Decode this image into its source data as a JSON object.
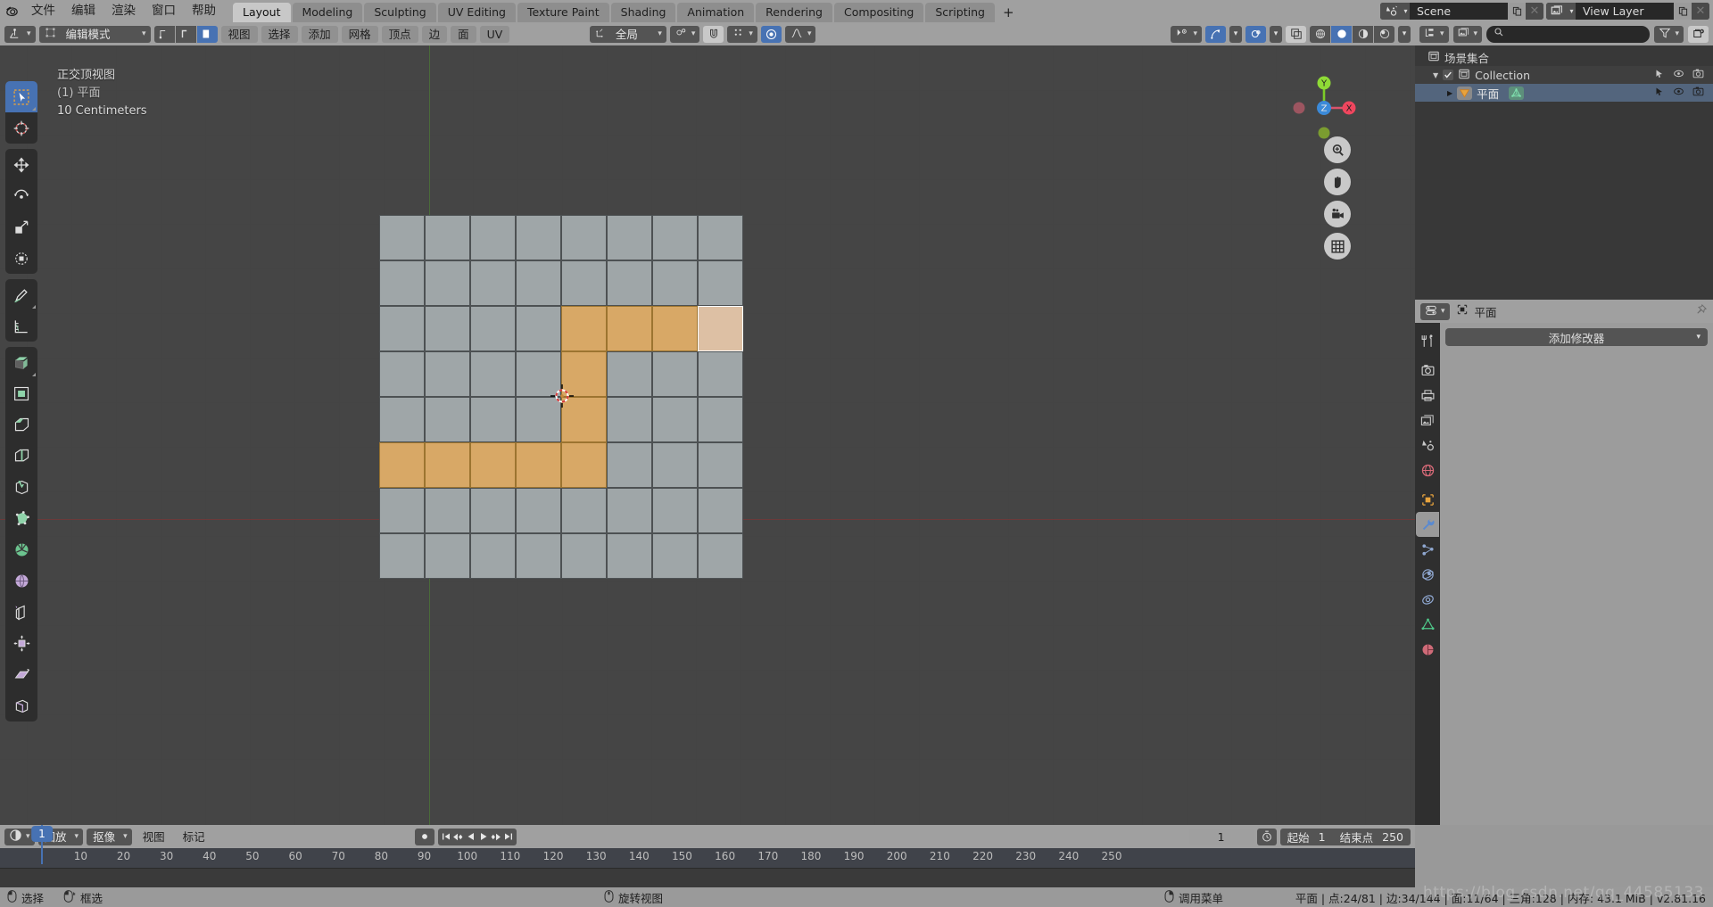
{
  "topbar": {
    "logo_icon": "blender-logo-icon",
    "menus": [
      "文件",
      "编辑",
      "渲染",
      "窗口",
      "帮助"
    ],
    "workspace_tabs": [
      {
        "label": "Layout",
        "active": true
      },
      {
        "label": "Modeling",
        "active": false
      },
      {
        "label": "Sculpting",
        "active": false
      },
      {
        "label": "UV Editing",
        "active": false
      },
      {
        "label": "Texture Paint",
        "active": false
      },
      {
        "label": "Shading",
        "active": false
      },
      {
        "label": "Animation",
        "active": false
      },
      {
        "label": "Rendering",
        "active": false
      },
      {
        "label": "Compositing",
        "active": false
      },
      {
        "label": "Scripting",
        "active": false
      }
    ],
    "add_workspace_label": "+",
    "scene": {
      "icon": "scene-icon",
      "value": "Scene",
      "new_label": "new-scene-icon",
      "unlink_label": "✕"
    },
    "view_layer": {
      "icon": "view-layer-icon",
      "value": "View Layer",
      "new_label": "new-layer-icon",
      "unlink_label": "✕"
    }
  },
  "viewport": {
    "header": {
      "editor_type_icon": "editor-type-3dview-icon",
      "mode": "编辑模式",
      "select_modes": [
        "vertex-select-icon",
        "edge-select-icon",
        "face-select-icon"
      ],
      "active_select_mode": 2,
      "menus": [
        "视图",
        "选择",
        "添加",
        "网格",
        "顶点",
        "边",
        "面",
        "UV"
      ],
      "transform_orientation": {
        "icon": "orientation-icon",
        "value": "全局"
      },
      "snap": {
        "icon": "snap-magnet-icon",
        "enabled": false
      },
      "proportional": {
        "icon": "proportional-edit-icon",
        "enabled": true,
        "falloff_icon": "falloff-smooth-icon"
      },
      "snap_target_icon": "snap-target-icon",
      "right": {
        "visibility_icon": "object-visibility-icon",
        "gizmo_icon": "gizmo-icon",
        "gizmo_enabled": true,
        "overlays_icon": "overlays-icon",
        "overlays_enabled": true,
        "xray_icon": "xray-toggle-icon",
        "shading_modes": [
          "wireframe-shading-icon",
          "solid-shading-icon",
          "material-preview-icon",
          "rendered-shading-icon"
        ],
        "active_shading": 1
      }
    },
    "overlay_text": {
      "view_name": "正交顶视图",
      "collection_object": "(1) 平面",
      "grid_scale": "10 Centimeters"
    },
    "toolbar": [
      {
        "name": "tweak-tool",
        "icon": "cursor-arrow-icon",
        "active": true
      },
      {
        "name": "cursor-tool",
        "icon": "3d-cursor-icon",
        "active": false
      },
      {
        "name": "move-tool",
        "icon": "move-arrows-icon",
        "active": false
      },
      {
        "name": "rotate-tool",
        "icon": "rotate-icon",
        "active": false
      },
      {
        "name": "scale-tool",
        "icon": "scale-icon",
        "active": false
      },
      {
        "name": "transform-tool",
        "icon": "transform-icon",
        "active": false
      },
      {
        "name": "annotate-tool",
        "icon": "pencil-icon",
        "active": false
      },
      {
        "name": "measure-tool",
        "icon": "ruler-icon",
        "active": false
      },
      {
        "name": "extrude-region-tool",
        "icon": "extrude-region-icon",
        "active": false
      },
      {
        "name": "inset-faces-tool",
        "icon": "inset-faces-icon",
        "active": false
      },
      {
        "name": "bevel-tool",
        "icon": "bevel-icon",
        "active": false
      },
      {
        "name": "loop-cut-tool",
        "icon": "loop-cut-icon",
        "active": false
      },
      {
        "name": "knife-tool",
        "icon": "knife-icon",
        "active": false
      },
      {
        "name": "poly-build-tool",
        "icon": "poly-build-icon",
        "active": false
      },
      {
        "name": "spin-tool",
        "icon": "spin-icon",
        "active": false
      },
      {
        "name": "smooth-tool",
        "icon": "smooth-icon",
        "active": false
      },
      {
        "name": "edge-slide-tool",
        "icon": "edge-slide-icon",
        "active": false
      },
      {
        "name": "shrink-fatten-tool",
        "icon": "shrink-fatten-icon",
        "active": false
      },
      {
        "name": "shear-tool",
        "icon": "shear-icon",
        "active": false
      },
      {
        "name": "rip-region-tool",
        "icon": "rip-region-icon",
        "active": false
      }
    ],
    "gizmo": {
      "x_label": "X",
      "y_label": "Y",
      "z_label": "Z"
    },
    "nav_buttons": [
      "zoom-icon",
      "pan-hand-icon",
      "camera-icon",
      "ortho-persp-grid-icon"
    ]
  },
  "mesh": {
    "cols": 8,
    "rows": 8,
    "selected_faces": [
      [
        2,
        4
      ],
      [
        2,
        5
      ],
      [
        2,
        6
      ],
      [
        3,
        4
      ],
      [
        4,
        4
      ],
      [
        5,
        0
      ],
      [
        5,
        1
      ],
      [
        5,
        2
      ],
      [
        5,
        3
      ],
      [
        5,
        4
      ]
    ],
    "active_face": [
      2,
      7
    ],
    "cursor_position": [
      4,
      4
    ]
  },
  "outliner": {
    "header": {
      "display_mode_icon": "outliner-display-mode-icon",
      "filter_id_icon": "filter-id-icon",
      "search_placeholder": "",
      "search_value": "",
      "filter_icon": "funnel-filter-icon",
      "new_collection_icon": "new-collection-icon"
    },
    "rows": [
      {
        "label": "场景集合",
        "icon": "scene-collection-icon",
        "indent": 0,
        "highlighted": false,
        "has_checkbox": false,
        "has_toggles": false
      },
      {
        "label": "Collection",
        "icon": "collection-icon",
        "indent": 1,
        "highlighted": false,
        "has_checkbox": true,
        "has_toggles": true,
        "expander": "▼"
      },
      {
        "label": "平面",
        "icon": "mesh-object-icon",
        "indent": 2,
        "highlighted": true,
        "has_checkbox": false,
        "has_toggles": true,
        "expander": "▶",
        "data_icon": "mesh-data-icon"
      }
    ],
    "toggle_icons": [
      "select-arrow-icon",
      "eye-visibility-icon",
      "camera-render-icon"
    ]
  },
  "properties": {
    "header": {
      "editor_type_icon": "editor-type-properties-icon",
      "breadcrumb_icon": "object-icon",
      "breadcrumb": "平面",
      "pin_icon": "pin-icon"
    },
    "tabs": [
      {
        "name": "tool-tab",
        "icon": "tool-wrench-screwdriver-icon",
        "active": false
      },
      {
        "name": "render-tab",
        "icon": "render-camera-back-icon",
        "active": false
      },
      {
        "name": "output-tab",
        "icon": "output-printer-icon",
        "active": false
      },
      {
        "name": "view-layer-tab",
        "icon": "view-layer-images-icon",
        "active": false
      },
      {
        "name": "scene-tab",
        "icon": "scene-cone-icon",
        "active": false
      },
      {
        "name": "world-tab",
        "icon": "world-globe-icon",
        "active": false
      },
      {
        "name": "object-tab",
        "icon": "object-square-icon",
        "active": false
      },
      {
        "name": "modifier-tab",
        "icon": "wrench-icon",
        "active": true
      },
      {
        "name": "particles-tab",
        "icon": "particles-icon",
        "active": false
      },
      {
        "name": "physics-tab",
        "icon": "physics-orbit-icon",
        "active": false
      },
      {
        "name": "constraints-tab",
        "icon": "constraints-icon",
        "active": false
      },
      {
        "name": "data-tab",
        "icon": "mesh-data-triangle-icon",
        "active": false
      },
      {
        "name": "material-tab",
        "icon": "material-sphere-icon",
        "active": false
      }
    ],
    "add_modifier_label": "添加修改器"
  },
  "timeline": {
    "header": {
      "editor_type_icon": "editor-type-timeline-icon",
      "menus": [
        {
          "label": "回放",
          "has_caret": true
        },
        {
          "label": "抠像",
          "has_caret": true
        },
        {
          "label": "视图",
          "has_caret": false
        },
        {
          "label": "标记",
          "has_caret": false
        }
      ],
      "record_icon": "record-keyframe-icon",
      "transport": [
        "jump-start-icon",
        "prev-keyframe-icon",
        "play-reverse-icon",
        "play-icon",
        "next-keyframe-icon",
        "jump-end-icon"
      ],
      "current_frame": "1",
      "use_preview_icon": "stopwatch-icon",
      "start_label": "起始",
      "start_value": "1",
      "end_label": "结束点",
      "end_value": "250"
    },
    "ticks": [
      10,
      20,
      30,
      40,
      50,
      60,
      70,
      80,
      90,
      100,
      110,
      120,
      130,
      140,
      150,
      160,
      170,
      180,
      190,
      200,
      210,
      220,
      230,
      240,
      250
    ],
    "playhead_frame": "1"
  },
  "statusbar": {
    "hints": [
      {
        "icon": "mouse-left-icon",
        "label": "选择"
      },
      {
        "icon": "mouse-left-drag-icon",
        "label": "框选"
      },
      {
        "icon": "mouse-middle-icon",
        "label": "旋转视图"
      },
      {
        "icon": "mouse-right-icon",
        "label": "调用菜单"
      }
    ],
    "scene_stats": "平面 | 点:24/81 | 边:34/144 | 面:11/64 | 三角:128 | 内存: 43.1 MiB | v2.81.16",
    "watermark": "https://blog.csdn.net/qq_44585133"
  },
  "colors": {
    "accent_blue": "#4772b3",
    "selected_face": "#d8a866",
    "active_face": "#ddc0a4",
    "unselected_face": "#9fa6a8",
    "header_gray": "#a0a0a0",
    "panel_gray": "#383838",
    "viewport_bg": "#3b3b3b"
  }
}
